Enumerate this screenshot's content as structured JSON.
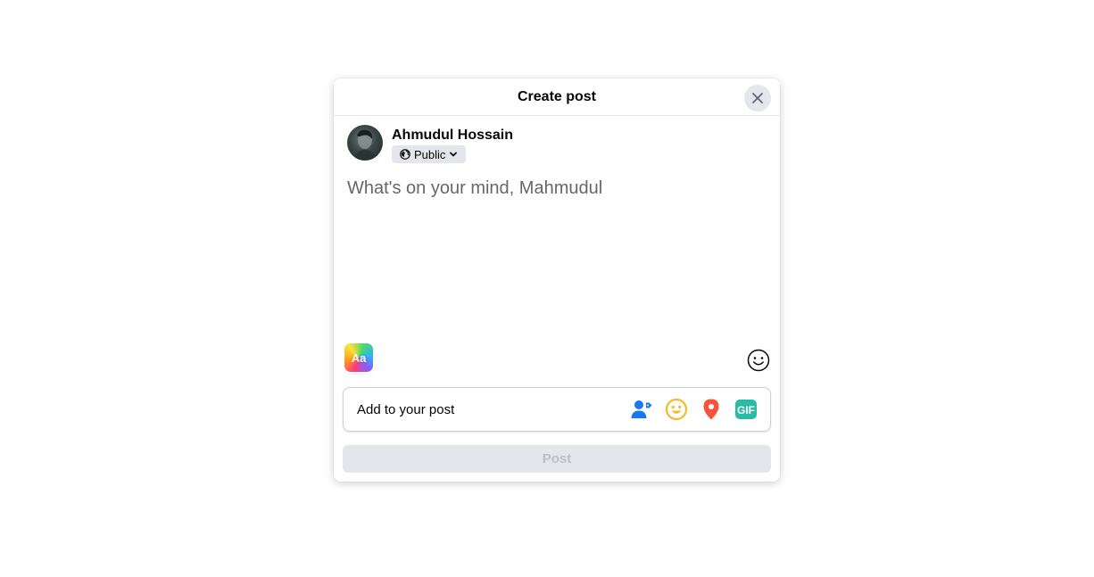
{
  "modal": {
    "title": "Create post",
    "close_icon": "close-icon"
  },
  "user": {
    "name": "Ahmudul Hossain",
    "audience": {
      "label": "Public",
      "globe_icon": "globe-icon",
      "chevron_icon": "chevron-down-icon"
    }
  },
  "composer": {
    "placeholder": "What's on your mind, Mahmudul"
  },
  "toolbar": {
    "text_style_label": "Aa",
    "emoji_icon": "smiley-outline-icon"
  },
  "add_to_post": {
    "label": "Add to your post",
    "icons": [
      {
        "name": "tag-people-icon",
        "color": "#1877f2"
      },
      {
        "name": "feeling-icon",
        "color": "#f7b928"
      },
      {
        "name": "location-icon",
        "color": "#f5533d"
      },
      {
        "name": "gif-icon",
        "label": "GIF",
        "color": "#2abba7"
      }
    ]
  },
  "post_button": {
    "label": "Post",
    "disabled": true
  },
  "colors": {
    "accent": "#1877f2",
    "surface_gray": "#e4e6eb",
    "disabled_text": "#bcc0c4"
  }
}
